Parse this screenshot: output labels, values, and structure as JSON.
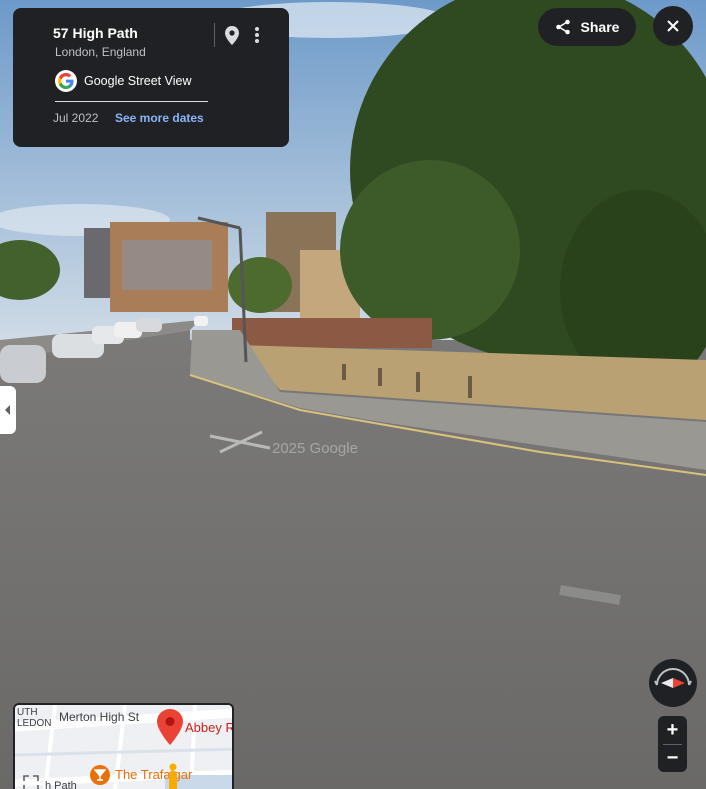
{
  "info_card": {
    "title": "57 High Path",
    "subtitle": "London, England",
    "source_label": "Google Street View",
    "date": "Jul 2022",
    "more_dates_label": "See more dates"
  },
  "top_right": {
    "share_label": "Share"
  },
  "watermark": "2025 Google",
  "minimap": {
    "labels": [
      "UTH",
      "LEDON",
      "Merton High St",
      "h Path"
    ],
    "abbey_label": "Abbey R",
    "trafalgar_label": "The Trafalgar"
  },
  "controls": {
    "zoom_in": "+",
    "zoom_out": "−"
  },
  "colors": {
    "panel_bg": "#202124",
    "link_blue": "#8ab4f8",
    "pin_red": "#ea4335",
    "poi_orange": "#e8710a"
  },
  "icons": [
    "pin-icon",
    "kebab-icon",
    "google-g-icon",
    "share-icon",
    "close-icon",
    "chevron-left-icon",
    "compass-icon",
    "fullscreen-icon",
    "map-pin-icon",
    "pegman-icon",
    "cocktail-icon"
  ]
}
